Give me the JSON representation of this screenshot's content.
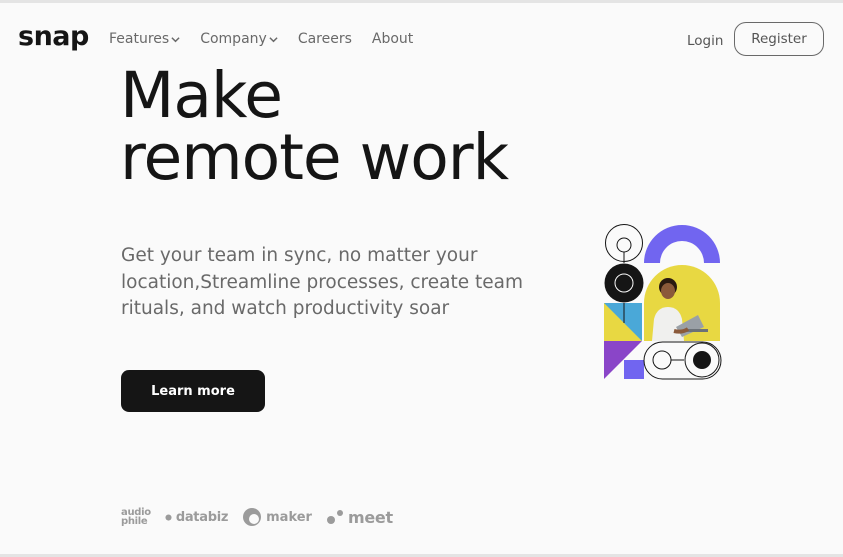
{
  "brand": {
    "logo": "snap"
  },
  "nav": {
    "items": [
      {
        "label": "Features",
        "dropdown": true
      },
      {
        "label": "Company",
        "dropdown": true
      },
      {
        "label": "Careers",
        "dropdown": false
      },
      {
        "label": "About",
        "dropdown": false
      }
    ],
    "login_label": "Login",
    "register_label": "Register"
  },
  "hero": {
    "headline_line1": "Make",
    "headline_line2": "remote work",
    "subtitle": "Get your team in sync, no matter your location,Streamline processes, create team rituals, and watch productivity soar",
    "cta_label": "Learn more"
  },
  "clients": {
    "audiophile_line1": "audio",
    "audiophile_line2": "phile",
    "databiz": "databiz",
    "maker": "maker",
    "meet": "meet"
  },
  "colors": {
    "text_dark": "#151515",
    "text_gray": "#696969",
    "background": "#fafafa",
    "accent_purple": "#7165f0",
    "accent_yellow": "#e8d842",
    "accent_blue": "#4aa8d8",
    "accent_violet": "#8a45c8"
  }
}
